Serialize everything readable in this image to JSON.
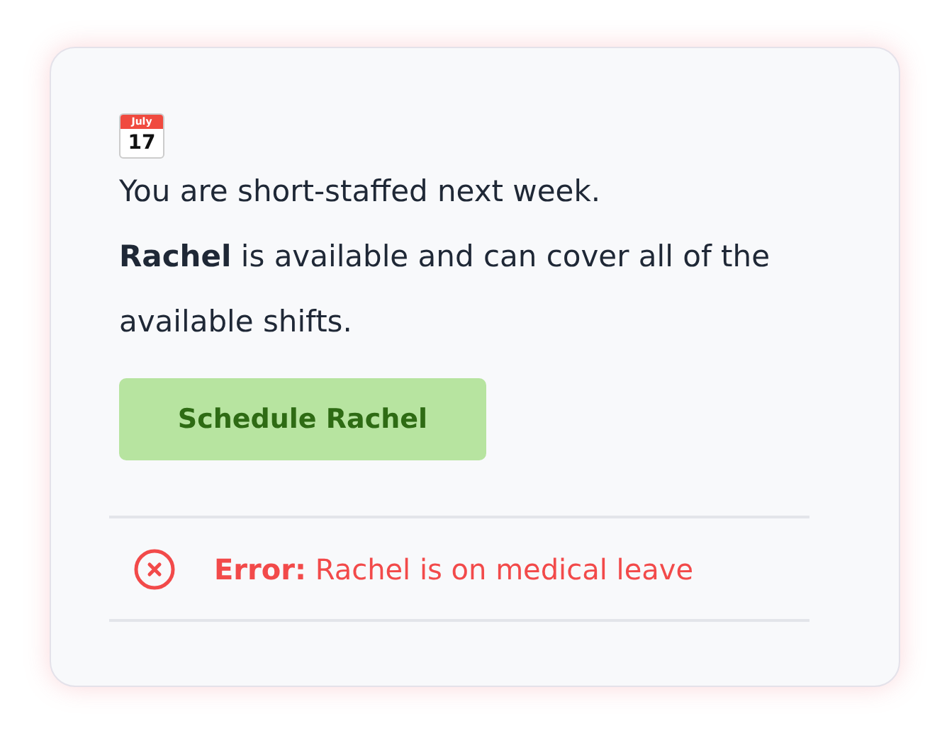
{
  "card": {
    "calendar": {
      "month": "July",
      "day": "17"
    },
    "messages": [
      "You are short-staffed next week.",
      "**Rachel** is available and can cover all of the available shifts."
    ],
    "button": {
      "label": "Schedule Rachel",
      "disabled": false
    },
    "error": {
      "label": "Error:",
      "text": "Rachel is on medical leave"
    }
  }
}
